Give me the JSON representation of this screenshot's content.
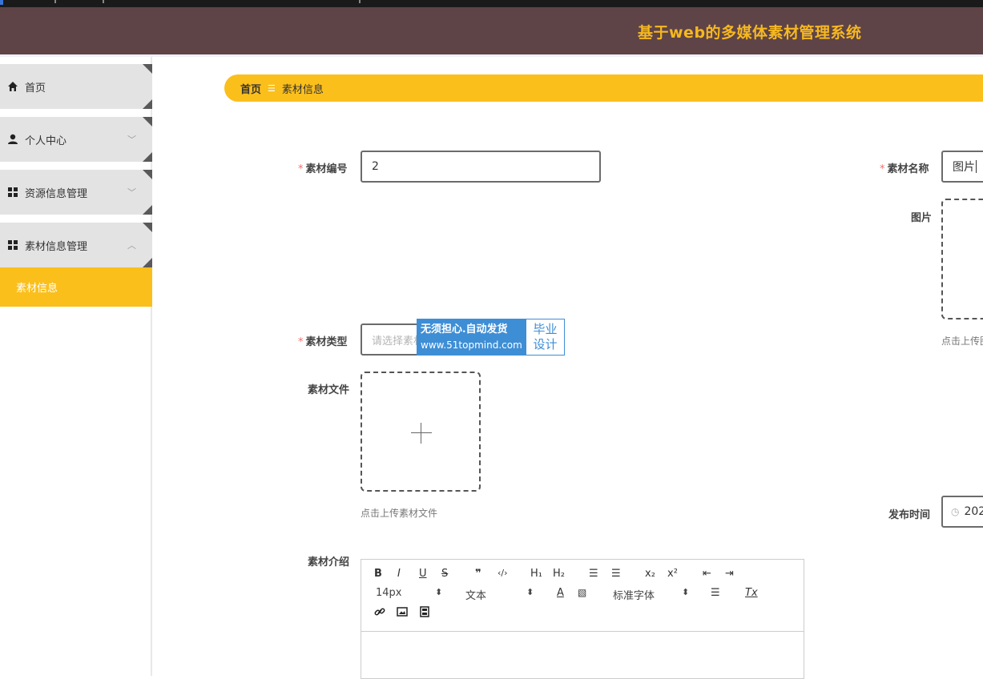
{
  "app": {
    "title": "基于web的多媒体素材管理系统",
    "accent_color": "#fbbf1c",
    "header_color": "#5e4347"
  },
  "sidebar": {
    "items": [
      {
        "label": "首页",
        "icon": "home-icon"
      },
      {
        "label": "个人中心",
        "icon": "user-icon",
        "chevron": "﹀"
      },
      {
        "label": "资源信息管理",
        "icon": "grid-icon",
        "chevron": "﹀"
      },
      {
        "label": "素材信息管理",
        "icon": "grid-icon",
        "chevron": "︿"
      }
    ],
    "active_sub": "素材信息"
  },
  "breadcrumb": {
    "home": "首页",
    "separator": "☰",
    "current": "素材信息"
  },
  "form": {
    "code_label": "素材编号",
    "code_value": "2",
    "name_label": "素材名称",
    "name_value": "图片",
    "image_label": "图片",
    "image_hint": "点击上传图",
    "type_label": "素材类型",
    "type_placeholder": "请选择素材类型",
    "file_label": "素材文件",
    "file_hint": "点击上传素材文件",
    "time_label": "发布时间",
    "time_value": "202",
    "intro_label": "素材介绍"
  },
  "watermark": {
    "line1": "无须担心.自动发货",
    "line2": "www.51topmind.com",
    "right1": "毕业",
    "right2": "设计"
  },
  "editor": {
    "bold": "B",
    "italic": "I",
    "underline": "U",
    "strike": "S",
    "quote": "❞",
    "code": "‹/›",
    "h1": "H₁",
    "h2": "H₂",
    "ordered": "☰",
    "bullet": "☰",
    "sub": "x₂",
    "sup": "x²",
    "outdent": "⇤",
    "indent": "⇥",
    "size": "14px",
    "paragraph": "文本",
    "font": "标准字体",
    "color": "A",
    "clean": "Tx"
  }
}
